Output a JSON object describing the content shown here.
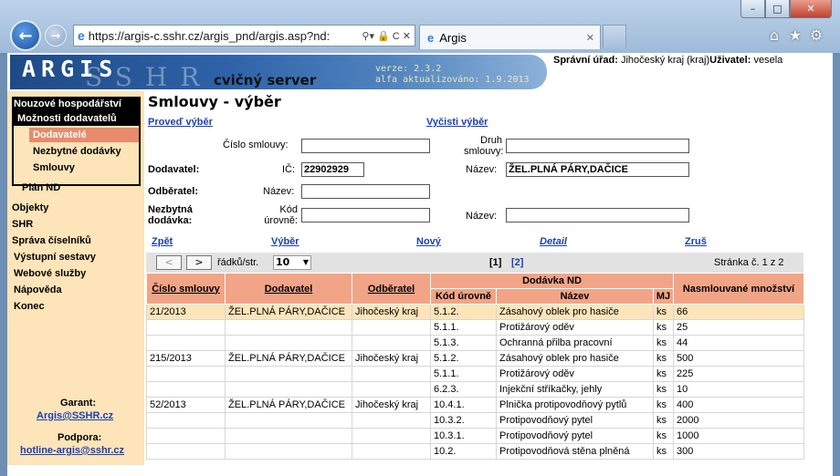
{
  "browser": {
    "url": "https://argis-c.sshr.cz/argis_pnd/argis.asp?nd:",
    "tab_title": "Argis",
    "window_min": "–",
    "window_max": "□",
    "window_close": "✕"
  },
  "header": {
    "logo": "ARGIS",
    "logo_sub": "SSHR",
    "server": "cvičný server",
    "version": "verze: 2.3.2",
    "updated": "alfa aktualizováno: 1.9.2013",
    "office_label": "Správní úřad:",
    "office_value": "Jihočeský kraj (kraj)",
    "user_label": "Uživatel:",
    "user_value": "vesela"
  },
  "menu": {
    "nouzove": "Nouzové hospodářství",
    "moznosti": "Možnosti dodavatelů",
    "dodavatele": "Dodavatelé",
    "nezbytne": "Nezbytné dodávky",
    "smlouvy": "Smlouvy",
    "plan": "Plán ND",
    "objekty": "Objekty",
    "shr": "SHR",
    "sprava": "Správa číselníků",
    "vystupni": "Výstupní sestavy",
    "webove": "Webové služby",
    "napoveda": "Nápověda",
    "konec": "Konec",
    "garant_label": "Garant:",
    "garant_mail": "Argis@SSHR.cz",
    "podpora_label": "Podpora:",
    "podpora_mail": "hotline-argis@sshr.cz"
  },
  "main": {
    "title": "Smlouvy - výběr",
    "run_link": "Proveď výběr",
    "clear_link": "Vyčisti výběr",
    "form": {
      "cislo_label": "Číslo smlouvy:",
      "cislo_value": "",
      "druh_label_1": "Druh",
      "druh_label_2": "smlouvy:",
      "druh_value": "",
      "dodavatel_label": "Dodavatel:",
      "ic_label": "IČ:",
      "ic_value": "22902929",
      "nazev_label": "Název:",
      "nazev_dod_value": "ŽEL.PLNÁ PÁRY,DAČICE",
      "odberatel_label": "Odběratel:",
      "nazev_odb_label": "Název:",
      "nazev_odb_value": "",
      "nezbytna_label_1": "Nezbytná",
      "nezbytna_label_2": "dodávka:",
      "kod_label_1": "Kód",
      "kod_label_2": "úrovně:",
      "kod_value": "",
      "nazev_nd_label": "Název:",
      "nazev_nd_value": ""
    },
    "actions": {
      "zpet": "Zpět",
      "vyber": "Výběr",
      "novy": "Nový",
      "detail": "Detail",
      "zrus": "Zruš"
    },
    "pager": {
      "prev": "<",
      "next": ">",
      "rows_label": "řádků/str.",
      "rows_value": "10",
      "page1": "[1]",
      "page2": "[2]",
      "page_info": "Stránka č. 1 z 2"
    },
    "table": {
      "headers": {
        "cislo": "Číslo smlouvy",
        "dodavatel": "Dodavatel",
        "odberatel": "Odběratel",
        "dodavka": "Dodávka ND",
        "kod": "Kód úrovně",
        "nazev": "Název",
        "mj": "MJ",
        "mnozstvi": "Nasmlouvané množství"
      },
      "rows": [
        {
          "cislo": "21/2013",
          "dodavatel": "ŽEL.PLNÁ PÁRY,DAČICE",
          "odberatel": "Jihočeský kraj",
          "kod": "5.1.2.",
          "nazev": "Zásahový oblek pro hasiče",
          "mj": "ks",
          "mnozstvi": "66"
        },
        {
          "cislo": "",
          "dodavatel": "",
          "odberatel": "",
          "kod": "5.1.1.",
          "nazev": "Protižárový oděv",
          "mj": "ks",
          "mnozstvi": "25"
        },
        {
          "cislo": "",
          "dodavatel": "",
          "odberatel": "",
          "kod": "5.1.3.",
          "nazev": "Ochranná přilba pracovní",
          "mj": "ks",
          "mnozstvi": "44"
        },
        {
          "cislo": "215/2013",
          "dodavatel": "ŽEL.PLNÁ PÁRY,DAČICE",
          "odberatel": "Jihočeský kraj",
          "kod": "5.1.2.",
          "nazev": "Zásahový oblek pro hasiče",
          "mj": "ks",
          "mnozstvi": "500"
        },
        {
          "cislo": "",
          "dodavatel": "",
          "odberatel": "",
          "kod": "5.1.1.",
          "nazev": "Protižárový oděv",
          "mj": "ks",
          "mnozstvi": "225"
        },
        {
          "cislo": "",
          "dodavatel": "",
          "odberatel": "",
          "kod": "6.2.3.",
          "nazev": "Injekční stříkačky, jehly",
          "mj": "ks",
          "mnozstvi": "10"
        },
        {
          "cislo": "52/2013",
          "dodavatel": "ŽEL.PLNÁ PÁRY,DAČICE",
          "odberatel": "Jihočeský kraj",
          "kod": "10.4.1.",
          "nazev": "Plnička protipovodňový pytlů",
          "mj": "ks",
          "mnozstvi": "400"
        },
        {
          "cislo": "",
          "dodavatel": "",
          "odberatel": "",
          "kod": "10.3.2.",
          "nazev": "Protipovodňový pytel",
          "mj": "ks",
          "mnozstvi": "2000"
        },
        {
          "cislo": "",
          "dodavatel": "",
          "odberatel": "",
          "kod": "10.3.1.",
          "nazev": "Protipovodňový pytel",
          "mj": "ks",
          "mnozstvi": "1000"
        },
        {
          "cislo": "",
          "dodavatel": "",
          "odberatel": "",
          "kod": "10.2.",
          "nazev": "Protipovodňová stěna plněná",
          "mj": "ks",
          "mnozstvi": "300"
        }
      ]
    }
  }
}
